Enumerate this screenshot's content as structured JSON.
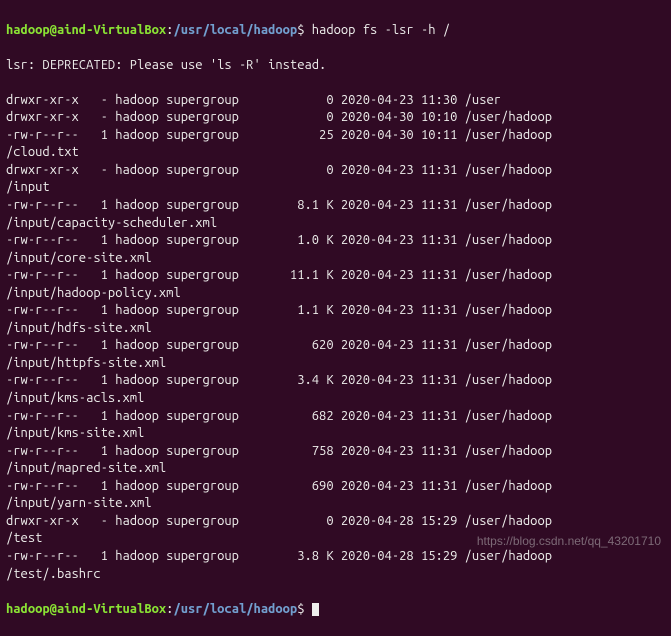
{
  "prompt": {
    "user_host": "hadoop@aind-VirtualBox",
    "colon": ":",
    "path": "/usr/local/hadoop",
    "dollar": "$"
  },
  "command": "hadoop fs -lsr -h /",
  "deprecated_msg": "lsr: DEPRECATED: Please use 'ls -R' instead.",
  "listing": [
    {
      "perms": "drwxr-xr-x",
      "links": "-",
      "owner": "hadoop",
      "group": "supergroup",
      "size": "0",
      "date": "2020-04-23",
      "time": "11:30",
      "path": "/user",
      "path2": ""
    },
    {
      "perms": "drwxr-xr-x",
      "links": "-",
      "owner": "hadoop",
      "group": "supergroup",
      "size": "0",
      "date": "2020-04-30",
      "time": "10:10",
      "path": "/user/hadoop",
      "path2": ""
    },
    {
      "perms": "-rw-r--r--",
      "links": "1",
      "owner": "hadoop",
      "group": "supergroup",
      "size": "25",
      "date": "2020-04-30",
      "time": "10:11",
      "path": "/user/hadoop",
      "path2": "/cloud.txt"
    },
    {
      "perms": "drwxr-xr-x",
      "links": "-",
      "owner": "hadoop",
      "group": "supergroup",
      "size": "0",
      "date": "2020-04-23",
      "time": "11:31",
      "path": "/user/hadoop",
      "path2": "/input"
    },
    {
      "perms": "-rw-r--r--",
      "links": "1",
      "owner": "hadoop",
      "group": "supergroup",
      "size": "8.1 K",
      "date": "2020-04-23",
      "time": "11:31",
      "path": "/user/hadoop",
      "path2": "/input/capacity-scheduler.xml"
    },
    {
      "perms": "-rw-r--r--",
      "links": "1",
      "owner": "hadoop",
      "group": "supergroup",
      "size": "1.0 K",
      "date": "2020-04-23",
      "time": "11:31",
      "path": "/user/hadoop",
      "path2": "/input/core-site.xml"
    },
    {
      "perms": "-rw-r--r--",
      "links": "1",
      "owner": "hadoop",
      "group": "supergroup",
      "size": "11.1 K",
      "date": "2020-04-23",
      "time": "11:31",
      "path": "/user/hadoop",
      "path2": "/input/hadoop-policy.xml"
    },
    {
      "perms": "-rw-r--r--",
      "links": "1",
      "owner": "hadoop",
      "group": "supergroup",
      "size": "1.1 K",
      "date": "2020-04-23",
      "time": "11:31",
      "path": "/user/hadoop",
      "path2": "/input/hdfs-site.xml"
    },
    {
      "perms": "-rw-r--r--",
      "links": "1",
      "owner": "hadoop",
      "group": "supergroup",
      "size": "620",
      "date": "2020-04-23",
      "time": "11:31",
      "path": "/user/hadoop",
      "path2": "/input/httpfs-site.xml"
    },
    {
      "perms": "-rw-r--r--",
      "links": "1",
      "owner": "hadoop",
      "group": "supergroup",
      "size": "3.4 K",
      "date": "2020-04-23",
      "time": "11:31",
      "path": "/user/hadoop",
      "path2": "/input/kms-acls.xml"
    },
    {
      "perms": "-rw-r--r--",
      "links": "1",
      "owner": "hadoop",
      "group": "supergroup",
      "size": "682",
      "date": "2020-04-23",
      "time": "11:31",
      "path": "/user/hadoop",
      "path2": "/input/kms-site.xml"
    },
    {
      "perms": "-rw-r--r--",
      "links": "1",
      "owner": "hadoop",
      "group": "supergroup",
      "size": "758",
      "date": "2020-04-23",
      "time": "11:31",
      "path": "/user/hadoop",
      "path2": "/input/mapred-site.xml"
    },
    {
      "perms": "-rw-r--r--",
      "links": "1",
      "owner": "hadoop",
      "group": "supergroup",
      "size": "690",
      "date": "2020-04-23",
      "time": "11:31",
      "path": "/user/hadoop",
      "path2": "/input/yarn-site.xml"
    },
    {
      "perms": "drwxr-xr-x",
      "links": "-",
      "owner": "hadoop",
      "group": "supergroup",
      "size": "0",
      "date": "2020-04-28",
      "time": "15:29",
      "path": "/user/hadoop",
      "path2": "/test"
    },
    {
      "perms": "-rw-r--r--",
      "links": "1",
      "owner": "hadoop",
      "group": "supergroup",
      "size": "3.8 K",
      "date": "2020-04-28",
      "time": "15:29",
      "path": "/user/hadoop",
      "path2": "/test/.bashrc"
    }
  ],
  "watermark": "https://blog.csdn.net/qq_43201710"
}
